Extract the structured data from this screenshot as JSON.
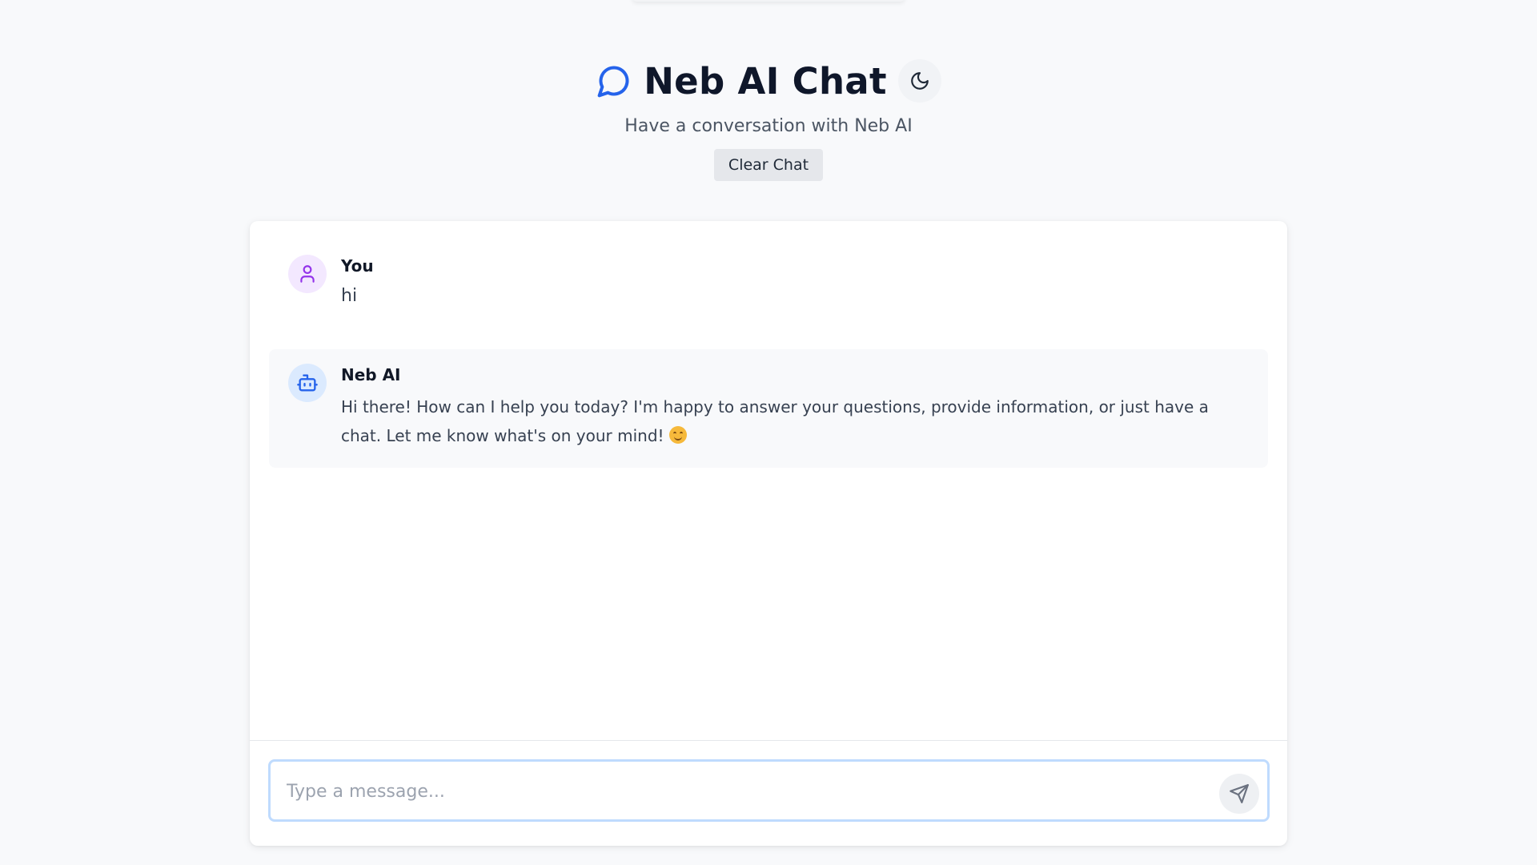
{
  "header": {
    "title": "Neb AI Chat",
    "subtitle": "Have a conversation with Neb AI",
    "clear_label": "Clear Chat"
  },
  "messages": [
    {
      "sender": "You",
      "role": "user",
      "text": "hi",
      "avatar_icon": "user-icon"
    },
    {
      "sender": "Neb AI",
      "role": "assistant",
      "text": "Hi there! How can I help you today? I'm happy to answer your questions, provide information, or just have a chat. Let me know what's on your mind!",
      "emoji": "😊",
      "avatar_icon": "bot-icon"
    }
  ],
  "composer": {
    "placeholder": "Type a message...",
    "value": "",
    "send_icon": "send-icon"
  },
  "icons": {
    "logo": "chat-bubble-icon",
    "theme_toggle": "moon-icon"
  },
  "colors": {
    "accent": "#2563eb",
    "user_avatar_bg": "#f3e8ff",
    "user_avatar_fg": "#9333ea",
    "bot_avatar_bg": "#dbeafe",
    "bot_avatar_fg": "#2563eb",
    "input_border": "#bfdbfe",
    "page_bg": "#f8f9fb"
  }
}
